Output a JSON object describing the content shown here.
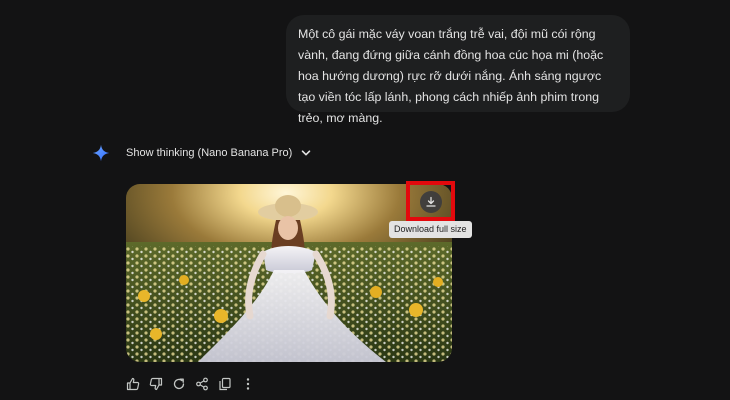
{
  "prompt": {
    "text": "Một cô gái mặc váy voan trắng trễ vai, đội mũ cói rộng vành, đang đứng giữa cánh đồng hoa cúc họa mi (hoặc hoa hướng dương) rực rỡ dưới nắng. Ánh sáng ngược tạo viền tóc lấp lánh, phong cách nhiếp ảnh phim trong trẻo, mơ màng."
  },
  "response": {
    "thinking_label": "Show thinking (Nano Banana Pro)",
    "download_tooltip": "Download full size"
  },
  "icons": {
    "model": "gemini-spark-icon",
    "toggle": "chevron-down-icon",
    "download": "download-icon",
    "actions": [
      "thumbs-up-icon",
      "thumbs-down-icon",
      "regenerate-icon",
      "share-icon",
      "copy-icon",
      "more-vert-icon"
    ]
  },
  "colors": {
    "background": "#131314",
    "bubble": "#1e1f20",
    "highlight": "#e3090d",
    "tooltip_bg": "#e3e3e3"
  }
}
